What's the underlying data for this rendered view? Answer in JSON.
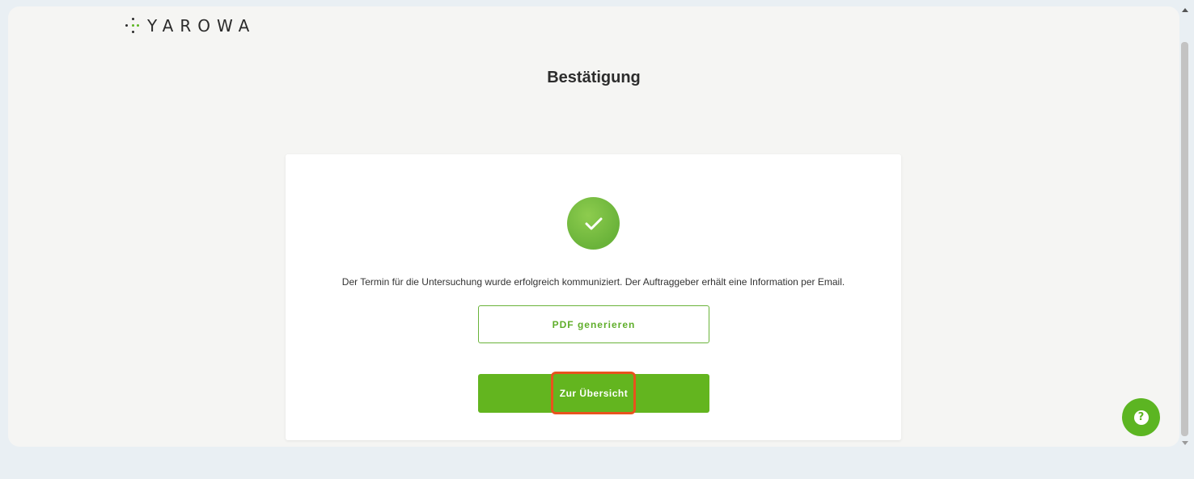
{
  "brand": {
    "logo_text": "YAROWA",
    "accent_color": "#63b51f",
    "highlight_color": "#e8531d"
  },
  "header": {
    "title": "Bestätigung"
  },
  "confirmation": {
    "icon": "checkmark-icon",
    "message": "Der Termin für die Untersuchung wurde erfolgreich kommuniziert. Der Auftraggeber erhält eine Information per Email.",
    "pdf_button_label": "PDF generieren",
    "overview_button_label": "Zur Übersicht"
  },
  "help": {
    "icon": "question-mark-icon",
    "glyph": "?"
  }
}
